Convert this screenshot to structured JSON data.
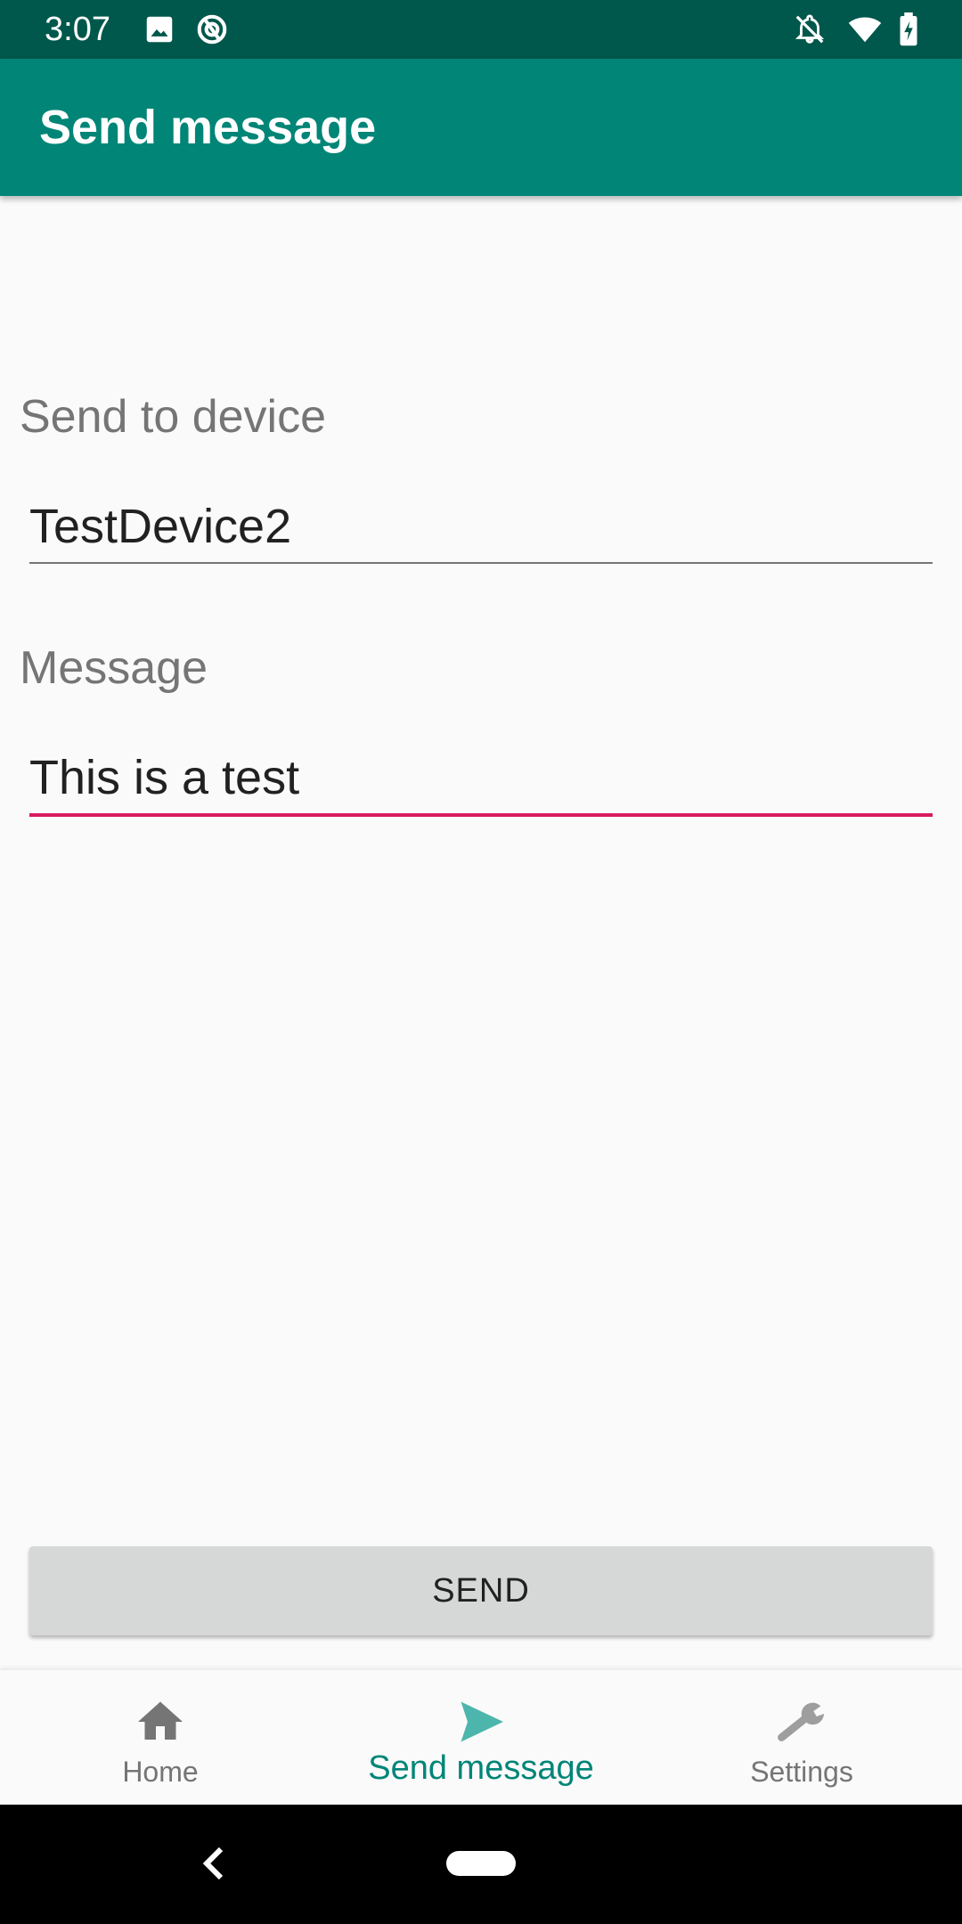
{
  "status_bar": {
    "time": "3:07",
    "icons": [
      "image-icon",
      "sync-icon",
      "notifications-off-icon",
      "wifi-icon",
      "battery-charging-icon"
    ]
  },
  "app_bar": {
    "title": "Send message"
  },
  "form": {
    "device": {
      "label": "Send to device",
      "value": "TestDevice2"
    },
    "message": {
      "label": "Message",
      "value": "This is a test"
    }
  },
  "send_button": {
    "label": "SEND"
  },
  "bottom_nav": {
    "items": [
      {
        "label": "Home",
        "icon": "home-icon",
        "active": false
      },
      {
        "label": "Send message",
        "icon": "send-icon",
        "active": true
      },
      {
        "label": "Settings",
        "icon": "wrench-icon",
        "active": false
      }
    ]
  },
  "colors": {
    "primary": "#008577",
    "primary_dark": "#00574b",
    "accent": "#d81b60",
    "inactive": "#757575"
  }
}
